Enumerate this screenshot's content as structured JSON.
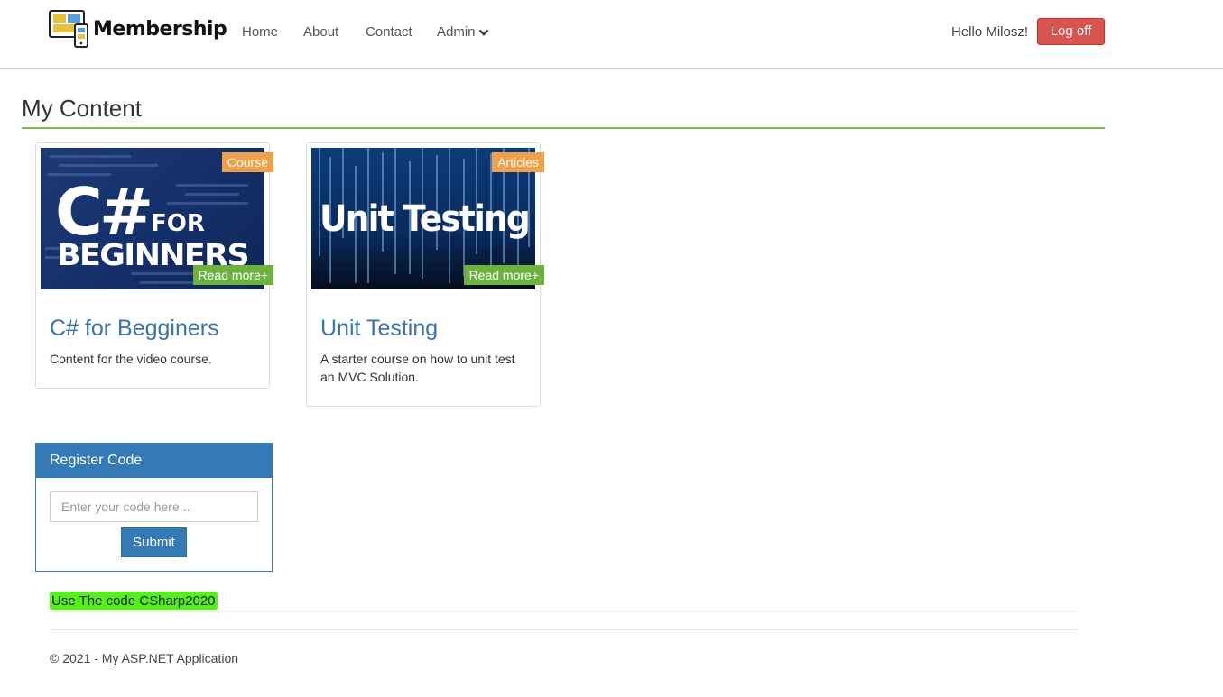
{
  "brand": {
    "name": "Membership"
  },
  "nav": {
    "home": "Home",
    "about": "About",
    "contact": "Contact",
    "admin": "Admin"
  },
  "user": {
    "greeting": "Hello Milosz!",
    "logoff_label": "Log off"
  },
  "page": {
    "title": "My Content"
  },
  "cards": [
    {
      "image_text_line1": "C#",
      "image_text_for": "FOR",
      "image_text_line2": "BEGINNERS",
      "tag": "Course",
      "read_more": "Read more+",
      "title": "C# for Begginers",
      "description": "Content for the video course."
    },
    {
      "image_text_line1": "Unit Testing",
      "tag": "Articles",
      "read_more": "Read more+",
      "title": "Unit Testing",
      "description": "A starter course on how to unit test an MVC Solution."
    }
  ],
  "register": {
    "heading": "Register Code",
    "placeholder": "Enter your code here...",
    "submit_label": "Submit"
  },
  "hint": "Use The code CSharp2020",
  "footer": "© 2021 - My ASP.NET Application",
  "colors": {
    "accent": "#337ab7",
    "danger": "#d9534f",
    "rule": "#7ab648",
    "tag": "#f0a048",
    "read_more": "#6cb33e",
    "highlight": "#55f01c"
  },
  "icons": {
    "brand": "devices-icon",
    "admin_caret": "chevron-down-icon"
  }
}
